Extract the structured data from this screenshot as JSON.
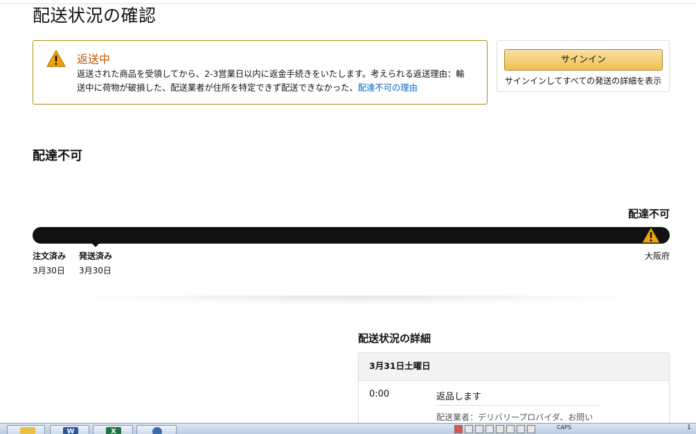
{
  "page": {
    "title": "配送状況の確認"
  },
  "alert": {
    "heading": "返送中",
    "body": "返送された商品を受領してから、2-3営業日以内に返金手続きをいたします。考えられる返送理由：輸送中に荷物が破損した、配送業者が住所を特定できず配送できなかった、",
    "link": "配達不可の理由",
    "icon": "warning-icon",
    "accent_color": "#c45500",
    "border_color": "#b38a0f"
  },
  "signin": {
    "button_label": "サインイン",
    "note": "サインインしてすべての発送の詳細を表示",
    "button_color": "#f0c14b"
  },
  "status": {
    "heading": "配達不可",
    "progress_label": "配達不可",
    "progress_warning_icon": "warning-icon",
    "progress_fraction": 1.0,
    "steps": [
      {
        "name": "注文済み",
        "date": "3月30日"
      },
      {
        "name": "発送済み",
        "date": "3月30日"
      }
    ],
    "location": "大阪府"
  },
  "details": {
    "heading": "配送状況の詳細",
    "date": "3月31日土曜日",
    "events": [
      {
        "time": "0:00",
        "description": "返品します",
        "carrier": "配送業者：デリバリープロバイダ、お問い"
      }
    ]
  },
  "taskbar": {
    "apps": [
      {
        "icon": "folder-icon"
      },
      {
        "icon": "word-icon",
        "glyph": "W"
      },
      {
        "icon": "excel-icon",
        "glyph": "X"
      },
      {
        "icon": "browser-icon"
      }
    ],
    "tray_text": "CAPS",
    "clock": "1"
  }
}
